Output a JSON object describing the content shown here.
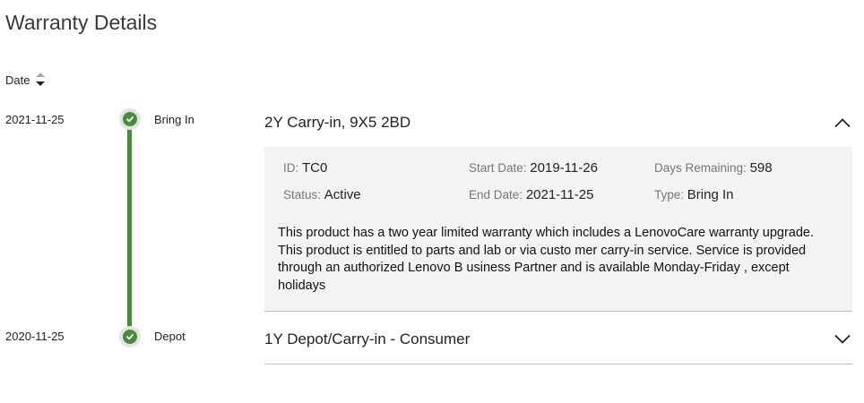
{
  "page": {
    "title": "Warranty Details"
  },
  "sort": {
    "label": "Date",
    "icon": "sort-icon"
  },
  "colors": {
    "timeline": "#4a8a3f",
    "node_bg": "#e3e3e3",
    "panel_bg": "#f3f3f3",
    "muted_label": "#777777"
  },
  "warranties": [
    {
      "date": "2021-11-25",
      "type": "Bring In",
      "title": "2Y Carry-in, 9X5 2BD",
      "expanded": true,
      "chevron_icon": "chevron-up-icon",
      "details": {
        "id_label": "ID",
        "id_value": "TC0",
        "start_label": "Start Date",
        "start_value": "2019-11-26",
        "days_label": "Days Remaining",
        "days_value": "598",
        "status_label": "Status",
        "status_value": "Active",
        "end_label": "End Date",
        "end_value": "2021-11-25",
        "type_label": "Type",
        "type_value": "Bring In",
        "description": "This product has a two year limited warranty which includes a LenovoCare warranty upgrade. This product is entitled to parts and lab or via custo mer carry-in service. Service is provided through an authorized Lenovo B usiness Partner and is available Monday-Friday , except holidays"
      }
    },
    {
      "date": "2020-11-25",
      "type": "Depot",
      "title": "1Y Depot/Carry-in - Consumer",
      "expanded": false,
      "chevron_icon": "chevron-down-icon"
    }
  ]
}
